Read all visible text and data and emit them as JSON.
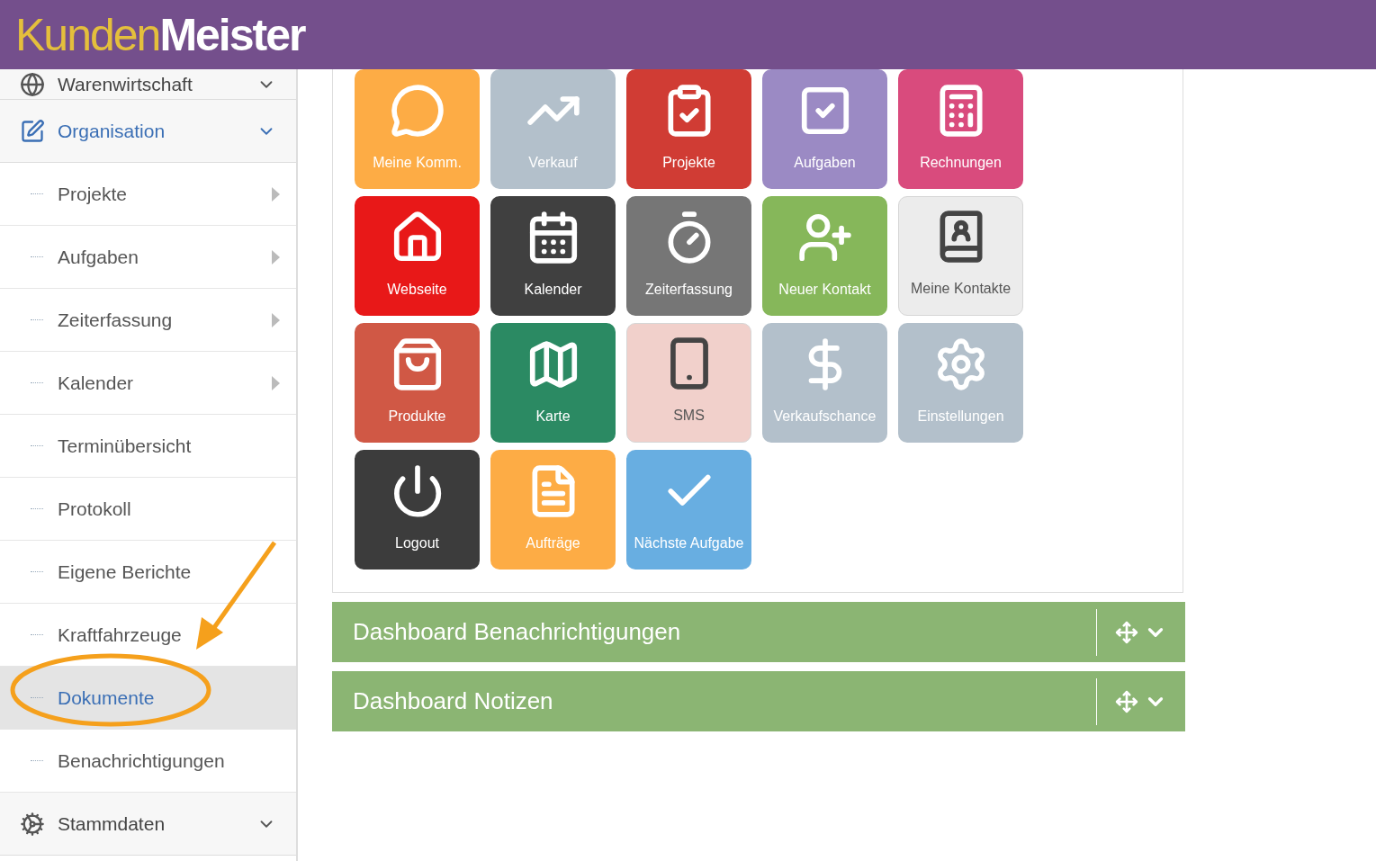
{
  "header": {
    "logo_part_1": "Kunden",
    "logo_part_2": "Meister"
  },
  "sidebar": {
    "items": [
      {
        "label": "Warenwirtschaft",
        "expanded": false
      },
      {
        "label": "Organisation",
        "expanded": true,
        "children": [
          {
            "label": "Projekte",
            "has_submenu": true,
            "selected": false
          },
          {
            "label": "Aufgaben",
            "has_submenu": true,
            "selected": false
          },
          {
            "label": "Zeiterfassung",
            "has_submenu": true,
            "selected": false
          },
          {
            "label": "Kalender",
            "has_submenu": true,
            "selected": false
          },
          {
            "label": "Terminübersicht",
            "has_submenu": false,
            "selected": false
          },
          {
            "label": "Protokoll",
            "has_submenu": false,
            "selected": false
          },
          {
            "label": "Eigene Berichte",
            "has_submenu": false,
            "selected": false
          },
          {
            "label": "Kraftfahrzeuge",
            "has_submenu": false,
            "selected": false
          },
          {
            "label": "Dokumente",
            "has_submenu": false,
            "selected": true
          },
          {
            "label": "Benachrichtigungen",
            "has_submenu": false,
            "selected": false
          }
        ]
      },
      {
        "label": "Stammdaten",
        "expanded": false
      }
    ]
  },
  "tiles": [
    {
      "label": "Meine Komm.",
      "color": "#fdac45"
    },
    {
      "label": "Verkauf",
      "color": "#b3c0cb"
    },
    {
      "label": "Projekte",
      "color": "#d03c34"
    },
    {
      "label": "Aufgaben",
      "color": "#9b8ac4"
    },
    {
      "label": "Rechnungen",
      "color": "#d94b7d"
    },
    {
      "label": "Webseite",
      "color": "#e81818"
    },
    {
      "label": "Kalender",
      "color": "#404040"
    },
    {
      "label": "Zeiterfassung",
      "color": "#767676"
    },
    {
      "label": "Neuer Kontakt",
      "color": "#86b75a"
    },
    {
      "label": "Meine Kontakte",
      "color": "#ececec"
    },
    {
      "label": "Produkte",
      "color": "#d05845"
    },
    {
      "label": "Karte",
      "color": "#2b8a63"
    },
    {
      "label": "SMS",
      "color": "#f1d0cb"
    },
    {
      "label": "Verkaufschance",
      "color": "#b3c0cb"
    },
    {
      "label": "Einstellungen",
      "color": "#b3c0cb"
    },
    {
      "label": "Logout",
      "color": "#3c3c3c"
    },
    {
      "label": "Aufträge",
      "color": "#fdac45"
    },
    {
      "label": "Nächste Aufgabe",
      "color": "#68aee1"
    }
  ],
  "widgets": [
    {
      "title": "Dashboard Benachrichtigungen",
      "expanded": false
    },
    {
      "title": "Dashboard Notizen",
      "expanded": false
    }
  ]
}
